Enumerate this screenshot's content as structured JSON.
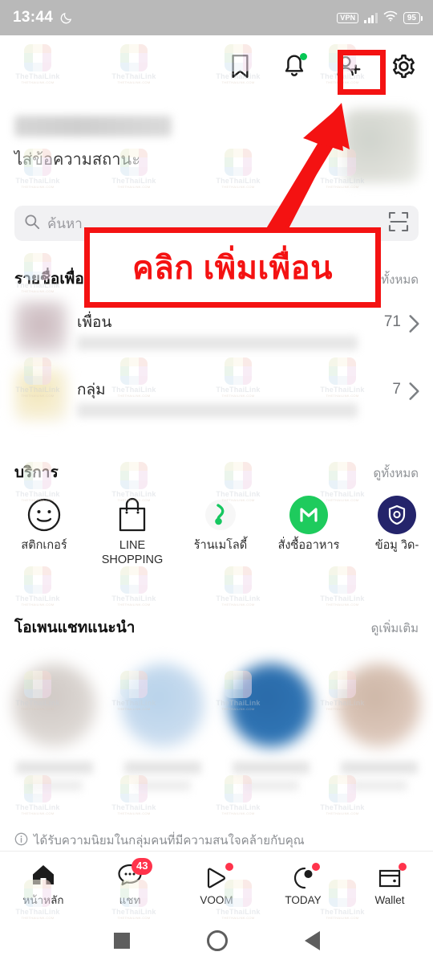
{
  "status_bar": {
    "time": "13:44",
    "moon_icon": "crescent-moon-icon",
    "vpn_label": "VPN",
    "signal_icon": "signal-bars-icon",
    "wifi_icon": "wifi-icon",
    "battery_level": "95"
  },
  "header": {
    "icons": [
      {
        "name": "bookmark-icon",
        "label": "bookmark"
      },
      {
        "name": "bell-icon",
        "label": "notifications",
        "has_green_dot": true
      },
      {
        "name": "add-friend-icon",
        "label": "add friend",
        "highlighted": true
      },
      {
        "name": "gear-icon",
        "label": "settings"
      }
    ]
  },
  "profile": {
    "name_blurred": "",
    "status_message": "ไส่ข้อความสถานะ",
    "avatar_blurred": ""
  },
  "search": {
    "placeholder": "ค้นหา",
    "search_icon": "search-icon",
    "qr_icon": "qr-scan-icon"
  },
  "friends_section": {
    "title": "รายชื่อเพื่อน",
    "see_all": "ดูทั้งหมด",
    "rows": [
      {
        "label": "เพื่อน",
        "count": "71",
        "chevron": "chevron-right-icon"
      },
      {
        "label": "กลุ่ม",
        "count": "7",
        "chevron": "chevron-right-icon"
      }
    ]
  },
  "services_section": {
    "title": "บริการ",
    "see_all": "ดูทั้งหมด",
    "items": [
      {
        "label": "สติกเกอร์",
        "icon": "smiley-face-icon",
        "icon_color": "#1f1f1f"
      },
      {
        "label": "LINE SHOPPING",
        "icon": "shopping-bag-icon",
        "icon_color": "#1f1f1f"
      },
      {
        "label": "ร้านเมโลดี้",
        "icon": "melody-note-icon",
        "icon_color": "#16c760"
      },
      {
        "label": "สั่งซื้ออาหาร",
        "icon": "line-man-m-icon",
        "icon_color": "#ffffff",
        "bg_color": "#1ecb5d"
      },
      {
        "label": "ข้อมู วิด-",
        "icon": "shield-covid-icon",
        "icon_color": "#ffffff",
        "bg_color": "#24246b"
      }
    ]
  },
  "openchat_section": {
    "title": "โอเพนแชทแนะนำ",
    "see_more": "ดูเพิ่มเติม",
    "cards": [
      {
        "avatar_color": "#cfc8c4"
      },
      {
        "avatar_color": "#b7d2ea"
      },
      {
        "avatar_color": "#2a6aa8"
      },
      {
        "avatar_color": "#cdb6a6"
      }
    ],
    "note": "ได้รับความนิยมในกลุ่มคนที่มีความสนใจคล้ายกับคุณ",
    "note_icon": "info-icon"
  },
  "bottom_nav": {
    "items": [
      {
        "label": "หน้าหลัก",
        "icon": "home-icon",
        "active": true
      },
      {
        "label": "แชท",
        "icon": "chat-bubble-icon",
        "badge": "43"
      },
      {
        "label": "VOOM",
        "icon": "voom-play-icon",
        "dot": true
      },
      {
        "label": "TODAY",
        "icon": "today-icon",
        "dot": true
      },
      {
        "label": "Wallet",
        "icon": "wallet-icon",
        "dot": true
      }
    ]
  },
  "android_nav": {
    "recents": "recents-square-icon",
    "home": "home-circle-icon",
    "back": "back-triangle-icon"
  },
  "annotations": {
    "callout_text": "คลิก เพิ่มเพื่อน",
    "accent_color": "#f41212",
    "arrow_icon": "arrow-up-right-icon"
  },
  "watermark": {
    "text": "TheThaiLink",
    "subtext": "THETHAILINK.COM"
  }
}
